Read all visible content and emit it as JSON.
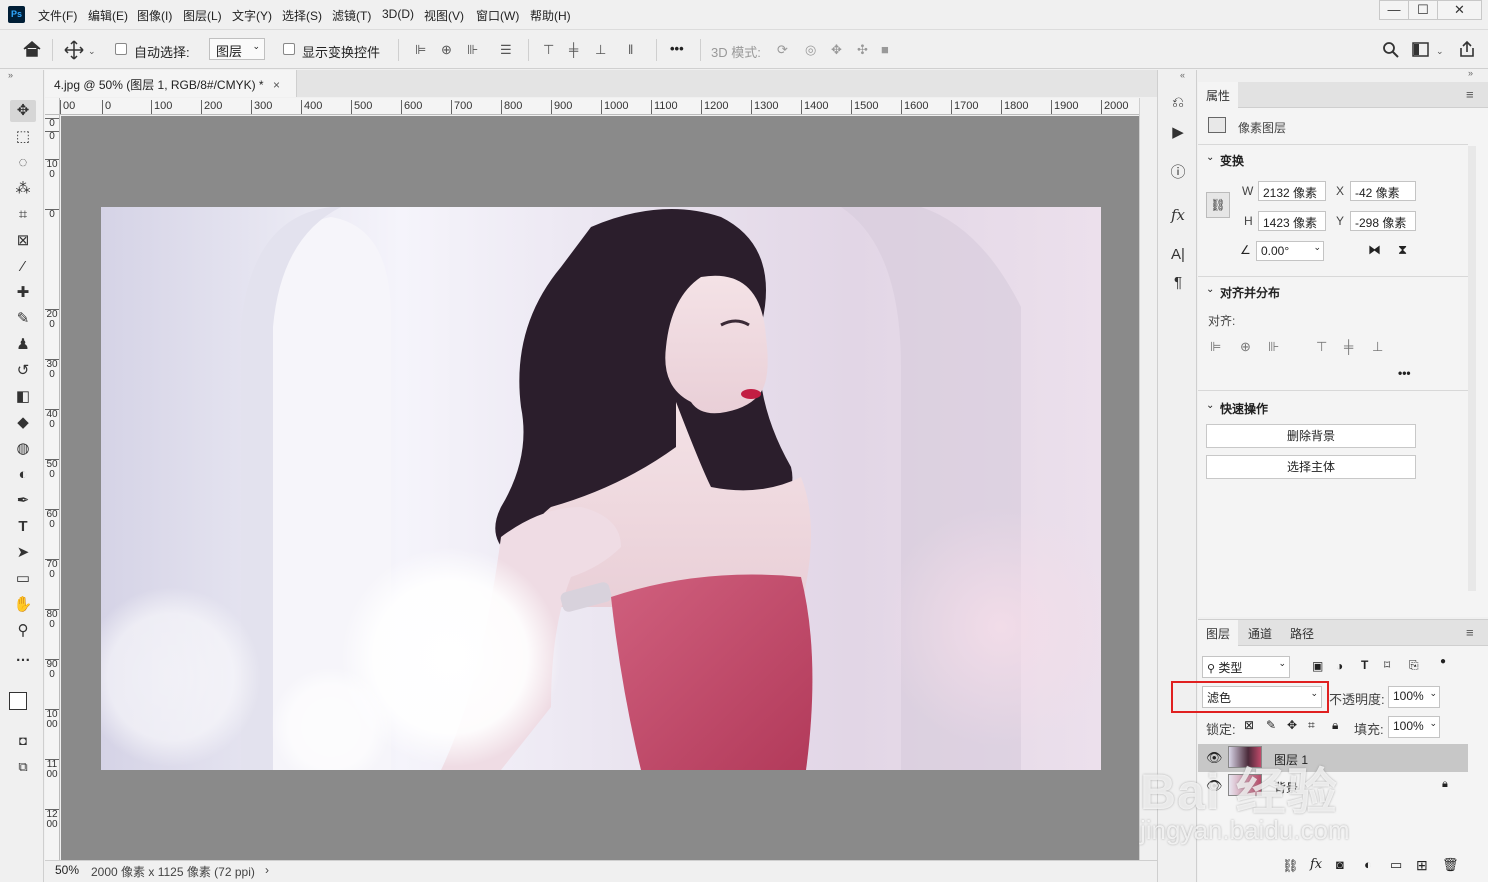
{
  "app": {
    "logo": "Ps"
  },
  "menu": [
    "文件(F)",
    "编辑(E)",
    "图像(I)",
    "图层(L)",
    "文字(Y)",
    "选择(S)",
    "滤镜(T)",
    "3D(D)",
    "视图(V)",
    "窗口(W)",
    "帮助(H)"
  ],
  "window_controls": {
    "minimize": "—",
    "maximize": "☐",
    "close": "✕"
  },
  "options": {
    "auto_select_label": "自动选择:",
    "auto_select_target": "图层",
    "show_transform_label": "显示变换控件",
    "more_label": "•••",
    "mode_3d_label": "3D 模式:"
  },
  "document": {
    "tab_title": "4.jpg @ 50% (图层 1, RGB/8#/CMYK) *",
    "zoom": "50%",
    "status": "2000 像素 x 1125 像素 (72 ppi)"
  },
  "ruler": {
    "h_labels": [
      "00",
      "0",
      "100",
      "200",
      "300",
      "400",
      "500",
      "600",
      "700",
      "800",
      "900",
      "1000",
      "1100",
      "1200",
      "1300",
      "1400",
      "1500",
      "1600",
      "1700",
      "1800",
      "1900",
      "2000"
    ],
    "v_labels": [
      "0",
      "0",
      "100",
      "0",
      "200",
      "300",
      "400",
      "500",
      "600",
      "700",
      "800",
      "900",
      "1000",
      "1100",
      "1200"
    ]
  },
  "properties": {
    "tab": "属性",
    "layer_type": "像素图层",
    "transform": {
      "title": "变换",
      "w_label": "W",
      "w_value": "2132 像素",
      "x_label": "X",
      "x_value": "-42 像素",
      "h_label": "H",
      "h_value": "1423 像素",
      "y_label": "Y",
      "y_value": "-298 像素",
      "angle_value": "0.00°"
    },
    "align": {
      "title": "对齐并分布",
      "label": "对齐:",
      "more": "•••"
    },
    "quick_actions": {
      "title": "快速操作",
      "remove_bg": "删除背景",
      "select_subject": "选择主体"
    }
  },
  "layers_panel": {
    "tabs": [
      "图层",
      "通道",
      "路径"
    ],
    "filter_kind": "类型",
    "blend_mode": "滤色",
    "opacity_label": "不透明度:",
    "opacity_value": "100%",
    "lock_label": "锁定:",
    "fill_label": "填充:",
    "fill_value": "100%",
    "layers": [
      {
        "name": "图层 1",
        "visible": true,
        "selected": true
      },
      {
        "name": "背景",
        "visible": true,
        "locked": true
      }
    ],
    "footer_icons": [
      "link-icon",
      "fx-icon",
      "mask-icon",
      "adjustment-icon",
      "folder-icon",
      "new-layer-icon",
      "trash-icon"
    ],
    "fx_label": "fx"
  },
  "watermark": {
    "line1": "Bai 经验",
    "line2": "jingyan.baidu.com"
  },
  "colors": {
    "highlight": "#e02020",
    "canvas_bg": "#8a8a8a",
    "ui_bg": "#f0f0f0"
  }
}
